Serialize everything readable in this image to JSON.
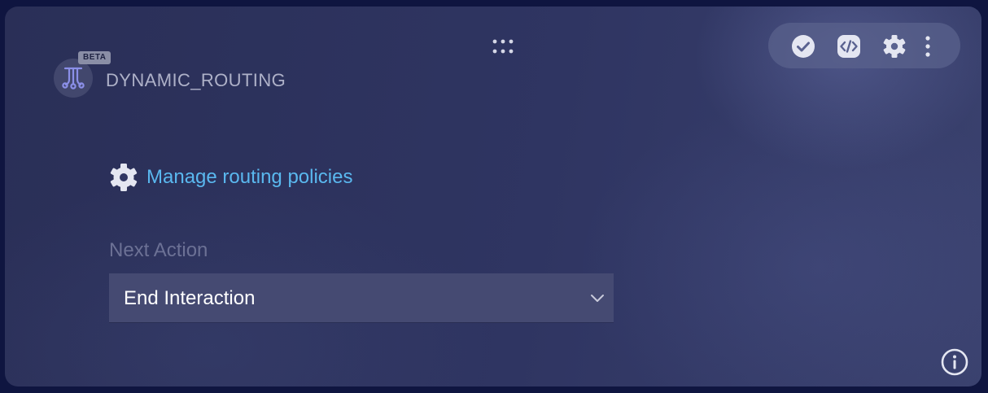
{
  "node": {
    "badge": "BETA",
    "title": "DYNAMIC_ROUTING",
    "icon": "routing-node-icon"
  },
  "toolbar": {
    "icons": [
      "check-circle-icon",
      "code-icon",
      "gear-icon",
      "more-vertical-icon"
    ]
  },
  "manage": {
    "label": "Manage routing policies",
    "icon": "gear-icon"
  },
  "next_action": {
    "label": "Next Action",
    "selected": "End Interaction"
  },
  "colors": {
    "link": "#5ab8ef",
    "card_bg": "#2f3562",
    "select_bg": "#454a72"
  }
}
